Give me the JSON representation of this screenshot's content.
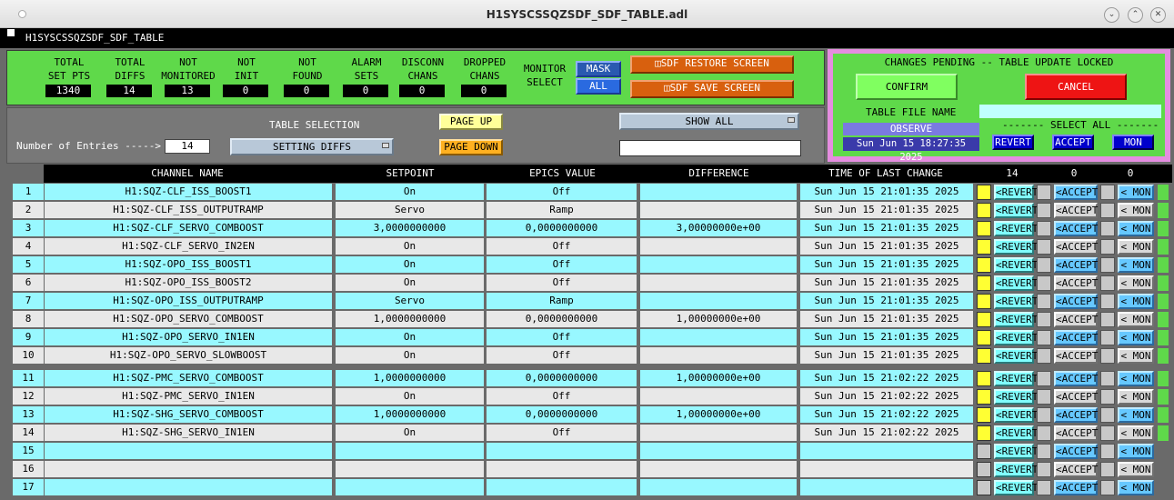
{
  "window": {
    "title": "H1SYSCSSQZSDF_SDF_TABLE.adl",
    "header_label": "H1SYSCSSQZSDF_SDF_TABLE"
  },
  "stats": [
    {
      "label1": "TOTAL",
      "label2": "SET PTS",
      "value": "1340"
    },
    {
      "label1": "TOTAL",
      "label2": "DIFFS",
      "value": "14"
    },
    {
      "label1": "NOT",
      "label2": "MONITORED",
      "value": "13"
    },
    {
      "label1": "NOT",
      "label2": "INIT",
      "value": "0"
    },
    {
      "label1": "NOT",
      "label2": "FOUND",
      "value": "0"
    },
    {
      "label1": "ALARM",
      "label2": "SETS",
      "value": "0"
    },
    {
      "label1": "DISCONN",
      "label2": "CHANS",
      "value": "0"
    },
    {
      "label1": "DROPPED",
      "label2": "CHANS",
      "value": "0"
    }
  ],
  "monitor_select": {
    "label1": "MONITOR",
    "label2": "SELECT",
    "mask": "MASK",
    "all": "ALL"
  },
  "screens": {
    "restore": "SDF RESTORE SCREEN",
    "save": "SDF SAVE SCREEN"
  },
  "table_controls": {
    "entries_label": "Number of Entries ----->",
    "entries_value": "14",
    "table_selection_label": "TABLE SELECTION",
    "table_selection_value": "SETTING DIFFS",
    "page_up": "PAGE UP",
    "page_down": "PAGE DOWN",
    "show_all": "SHOW ALL",
    "filter_value": ""
  },
  "pending": {
    "title": "CHANGES PENDING -- TABLE UPDATE LOCKED",
    "confirm": "CONFIRM",
    "cancel": "CANCEL",
    "table_file_label": "TABLE FILE NAME",
    "table_file_value": "",
    "observe": "OBSERVE",
    "timestamp": "Sun Jun 15 18:27:35 2025",
    "select_all": "------- SELECT ALL -------",
    "revert": "REVERT",
    "accept": "ACCEPT",
    "mon": "MON"
  },
  "columns": {
    "channel": "CHANNEL NAME",
    "setpoint": "SETPOINT",
    "epics": "EPICS VALUE",
    "diff": "DIFFERENCE",
    "time": "TIME OF LAST CHANGE",
    "count_revert": "14",
    "count_accept": "0",
    "count_mon": "0"
  },
  "row_buttons": {
    "revert": "<REVERT",
    "accept": "<ACCEPT",
    "mon": "< MON"
  },
  "rows": [
    {
      "num": "1",
      "channel": "H1:SQZ-CLF_ISS_BOOST1",
      "setpoint": "On",
      "epics": "Off",
      "diff": "",
      "time": "Sun Jun 15 21:01:35 2025"
    },
    {
      "num": "2",
      "channel": "H1:SQZ-CLF_ISS_OUTPUTRAMP",
      "setpoint": "Servo",
      "epics": "Ramp",
      "diff": "",
      "time": "Sun Jun 15 21:01:35 2025"
    },
    {
      "num": "3",
      "channel": "H1:SQZ-CLF_SERVO_COMBOOST",
      "setpoint": "3,0000000000",
      "epics": "0,0000000000",
      "diff": "3,00000000e+00",
      "time": "Sun Jun 15 21:01:35 2025"
    },
    {
      "num": "4",
      "channel": "H1:SQZ-CLF_SERVO_IN2EN",
      "setpoint": "On",
      "epics": "Off",
      "diff": "",
      "time": "Sun Jun 15 21:01:35 2025"
    },
    {
      "num": "5",
      "channel": "H1:SQZ-OPO_ISS_BOOST1",
      "setpoint": "On",
      "epics": "Off",
      "diff": "",
      "time": "Sun Jun 15 21:01:35 2025"
    },
    {
      "num": "6",
      "channel": "H1:SQZ-OPO_ISS_BOOST2",
      "setpoint": "On",
      "epics": "Off",
      "diff": "",
      "time": "Sun Jun 15 21:01:35 2025"
    },
    {
      "num": "7",
      "channel": "H1:SQZ-OPO_ISS_OUTPUTRAMP",
      "setpoint": "Servo",
      "epics": "Ramp",
      "diff": "",
      "time": "Sun Jun 15 21:01:35 2025"
    },
    {
      "num": "8",
      "channel": "H1:SQZ-OPO_SERVO_COMBOOST",
      "setpoint": "1,0000000000",
      "epics": "0,0000000000",
      "diff": "1,00000000e+00",
      "time": "Sun Jun 15 21:01:35 2025"
    },
    {
      "num": "9",
      "channel": "H1:SQZ-OPO_SERVO_IN1EN",
      "setpoint": "On",
      "epics": "Off",
      "diff": "",
      "time": "Sun Jun 15 21:01:35 2025"
    },
    {
      "num": "10",
      "channel": "H1:SQZ-OPO_SERVO_SLOWBOOST",
      "setpoint": "On",
      "epics": "Off",
      "diff": "",
      "time": "Sun Jun 15 21:01:35 2025"
    },
    {
      "num": "11",
      "channel": "H1:SQZ-PMC_SERVO_COMBOOST",
      "setpoint": "1,0000000000",
      "epics": "0,0000000000",
      "diff": "1,00000000e+00",
      "time": "Sun Jun 15 21:02:22 2025"
    },
    {
      "num": "12",
      "channel": "H1:SQZ-PMC_SERVO_IN1EN",
      "setpoint": "On",
      "epics": "Off",
      "diff": "",
      "time": "Sun Jun 15 21:02:22 2025"
    },
    {
      "num": "13",
      "channel": "H1:SQZ-SHG_SERVO_COMBOOST",
      "setpoint": "1,0000000000",
      "epics": "0,0000000000",
      "diff": "1,00000000e+00",
      "time": "Sun Jun 15 21:02:22 2025"
    },
    {
      "num": "14",
      "channel": "H1:SQZ-SHG_SERVO_IN1EN",
      "setpoint": "On",
      "epics": "Off",
      "diff": "",
      "time": "Sun Jun 15 21:02:22 2025"
    },
    {
      "num": "15",
      "channel": "",
      "setpoint": "",
      "epics": "",
      "diff": "",
      "time": ""
    },
    {
      "num": "16",
      "channel": "",
      "setpoint": "",
      "epics": "",
      "diff": "",
      "time": ""
    },
    {
      "num": "17",
      "channel": "",
      "setpoint": "",
      "epics": "",
      "diff": "",
      "time": ""
    }
  ],
  "colors": {
    "green": "#5fd94a",
    "cyan": "#80ffff",
    "yellow": "#ffff33",
    "pink": "#e58de0"
  }
}
